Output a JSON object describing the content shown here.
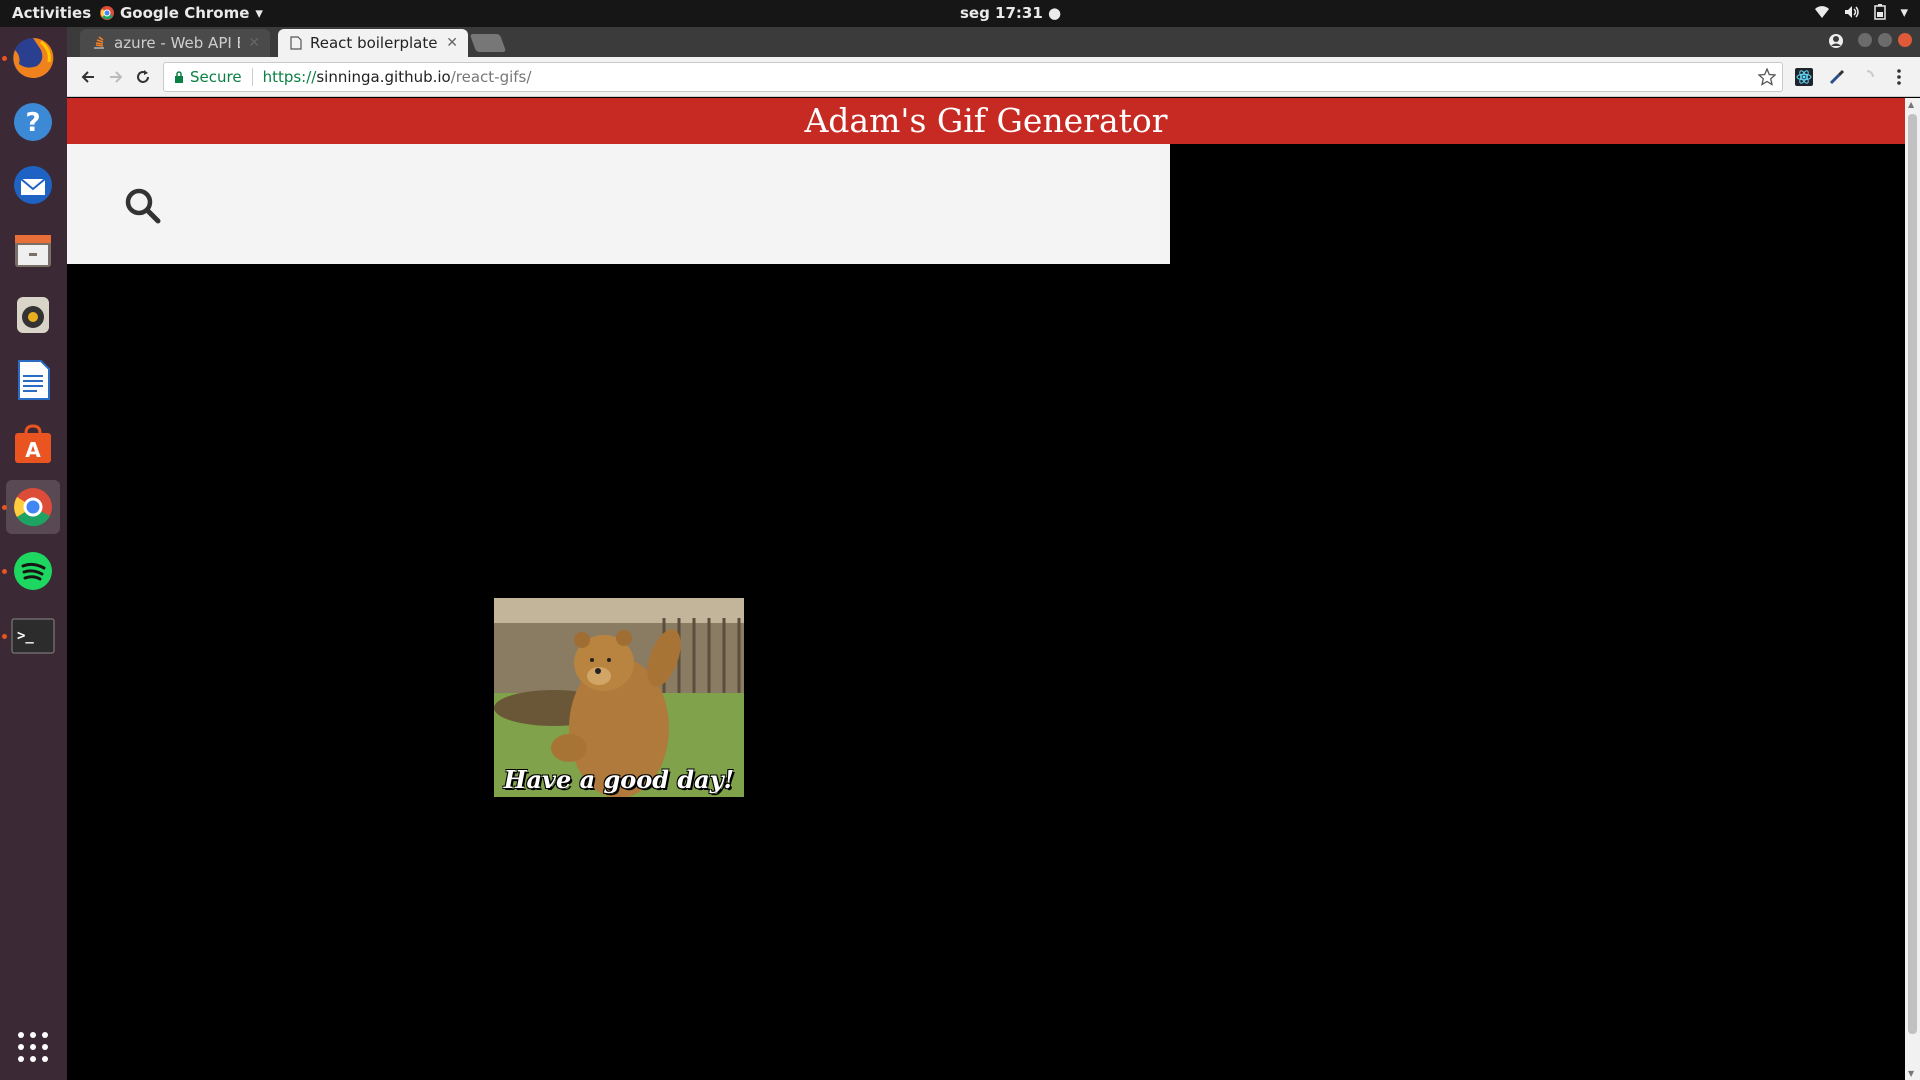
{
  "topbar": {
    "activities": "Activities",
    "app_menu": "Google Chrome",
    "clock": "seg 17:31"
  },
  "dock": {
    "items": [
      {
        "name": "firefox-icon"
      },
      {
        "name": "help-icon"
      },
      {
        "name": "thunderbird-icon"
      },
      {
        "name": "files-icon"
      },
      {
        "name": "rhythmbox-icon"
      },
      {
        "name": "writer-icon"
      },
      {
        "name": "software-icon"
      },
      {
        "name": "chrome-icon"
      },
      {
        "name": "spotify-icon"
      },
      {
        "name": "terminal-icon"
      },
      {
        "name": "show-apps-icon"
      }
    ]
  },
  "browser": {
    "tabs": [
      {
        "label": "azure - Web API Error",
        "active": false
      },
      {
        "label": "React boilerplate",
        "active": true
      }
    ],
    "secure_label": "Secure",
    "url_scheme": "https://",
    "url_host": "sinninga.github.io",
    "url_path": "/react-gifs/"
  },
  "page": {
    "title": "Adam's Gif Generator",
    "search_value": "",
    "gif_caption": "Have a good day!"
  },
  "colors": {
    "header": "#c62a22",
    "ubuntu_accent": "#e95420",
    "secure_green": "#0b8043"
  }
}
